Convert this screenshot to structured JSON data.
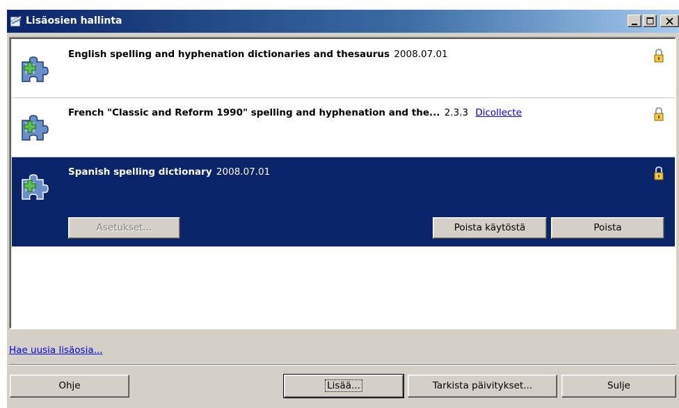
{
  "window": {
    "title": "Lisäosien hallinta",
    "controls": [
      "minimize",
      "maximize",
      "close"
    ]
  },
  "extensions": [
    {
      "name": "English spelling and hyphenation dictionaries and thesaurus",
      "version": "2008.07.01",
      "link": "",
      "icon": "puzzle-icon",
      "locked": true,
      "selected": false
    },
    {
      "name": "French \"Classic and Reform 1990\" spelling and hyphenation and the...",
      "version": "2.3.3",
      "link": "Dicollecte",
      "icon": "puzzle-icon",
      "locked": true,
      "selected": false
    },
    {
      "name": "Spanish spelling dictionary",
      "version": "2008.07.01",
      "link": "",
      "icon": "puzzle-icon",
      "locked": true,
      "selected": true,
      "buttons": {
        "options": "Asetukset...",
        "disable": "Poista käytöstä",
        "remove": "Poista"
      }
    }
  ],
  "find_more_link": "Hae uusia lisäosia...",
  "footer": {
    "help": "Ohje",
    "add": "Lisää...",
    "check_updates": "Tarkista päivitykset...",
    "close": "Sulje"
  },
  "colors": {
    "titlebar_start": "#0a246a",
    "titlebar_end": "#a6caf0",
    "selection": "#0a246a",
    "face": "#d4d0c8",
    "link": "#0000ee"
  }
}
